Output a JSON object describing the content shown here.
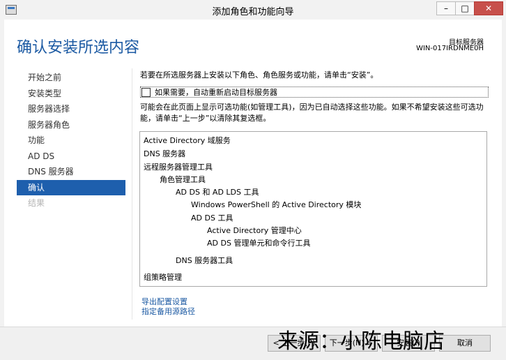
{
  "window": {
    "title": "添加角色和功能向导",
    "controls": {
      "minimize": "–",
      "maximize": "□",
      "close": "✕"
    }
  },
  "header": {
    "page_title": "确认安装所选内容",
    "destination_label": "目标服务器",
    "destination_server": "WIN-017IRDNME0H"
  },
  "nav": {
    "items": [
      {
        "label": "开始之前",
        "state": "normal"
      },
      {
        "label": "安装类型",
        "state": "normal"
      },
      {
        "label": "服务器选择",
        "state": "normal"
      },
      {
        "label": "服务器角色",
        "state": "normal"
      },
      {
        "label": "功能",
        "state": "normal"
      },
      {
        "label": "AD DS",
        "state": "normal"
      },
      {
        "label": "DNS 服务器",
        "state": "normal"
      },
      {
        "label": "确认",
        "state": "active"
      },
      {
        "label": "结果",
        "state": "disabled"
      }
    ]
  },
  "main": {
    "intro": "若要在所选服务器上安装以下角色、角色服务或功能，请单击“安装”。",
    "restart_checkbox_label": "如果需要，自动重新启动目标服务器",
    "restart_checked": false,
    "note": "可能会在此页面上显示可选功能(如管理工具)，因为已自动选择这些功能。如果不希望安装这些可选功能，请单击“上一步”以清除其复选框。",
    "features": [
      "Active Directory 域服务",
      "DNS 服务器",
      "远程服务器管理工具",
      "角色管理工具",
      "AD DS 和 AD LDS 工具",
      "Windows PowerShell 的 Active Directory 模块",
      "AD DS 工具",
      "Active Directory 管理中心",
      "AD DS 管理单元和命令行工具",
      "DNS 服务器工具",
      "组策略管理"
    ],
    "links": {
      "export": "导出配置设置",
      "alt_source": "指定备用源路径"
    }
  },
  "footer": {
    "previous": "< 上一步(P)",
    "next": "下一步(N) >",
    "install": "安装(I)",
    "cancel": "取消"
  },
  "watermark": "来源：小陈电脑店",
  "colors": {
    "accent": "#1e5fad",
    "title_text": "#1c5aa3",
    "close_button": "#c7504b"
  }
}
